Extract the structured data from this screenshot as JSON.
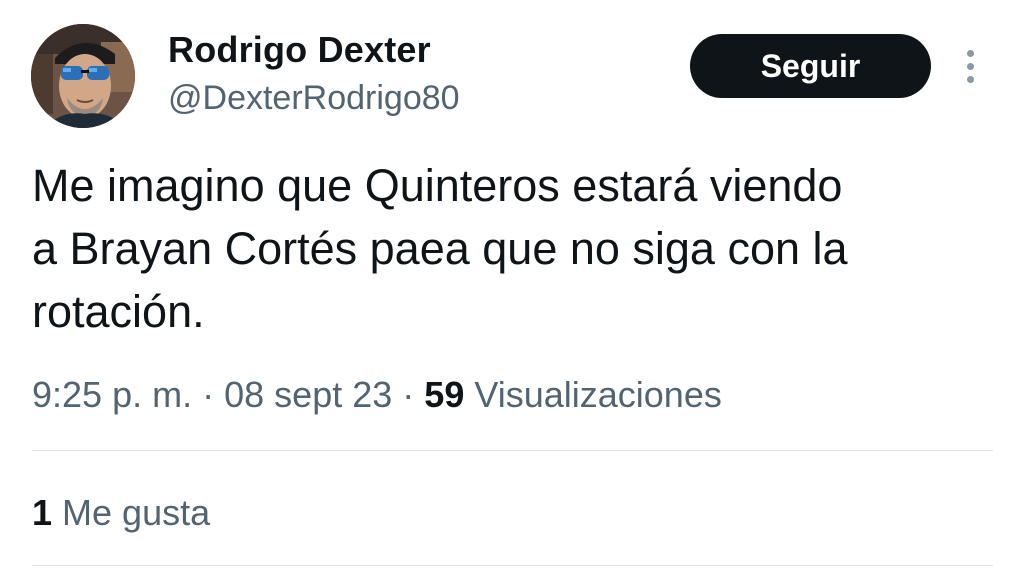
{
  "author": {
    "name": "Rodrigo Dexter",
    "handle": "@DexterRodrigo80"
  },
  "actions": {
    "follow_label": "Seguir"
  },
  "tweet": {
    "text": "Me imagino que Quinteros estará viendo\na Brayan Cortés paea que no siga con la\nrotación."
  },
  "meta": {
    "time": "9:25 p. m.",
    "separator": "·",
    "date": "08 sept 23",
    "views_count": "59",
    "views_label": "Visualizaciones"
  },
  "stats": {
    "likes_count": "1",
    "likes_label": "Me gusta"
  },
  "icons": {
    "avatar": "profile-photo",
    "more": "more-vertical-icon"
  },
  "colors": {
    "primary_text": "#0f1419",
    "secondary_text": "#536471",
    "button_bg": "#0f1419",
    "divider": "#dfe3e6"
  }
}
